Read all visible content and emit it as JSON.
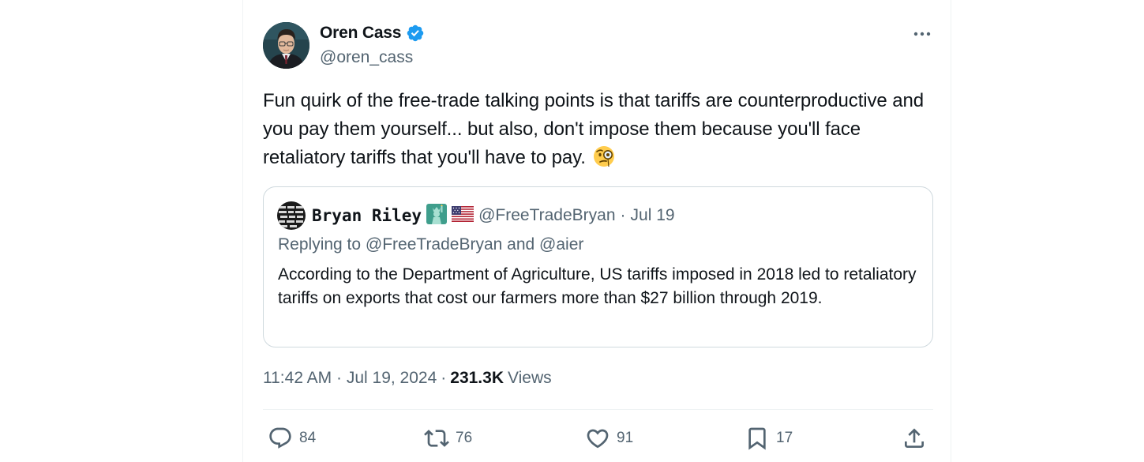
{
  "tweet": {
    "author_name": "Oren Cass",
    "author_handle": "@oren_cass",
    "text": "Fun quirk of the free-trade talking points is that tariffs are counterproductive and you pay them yourself... but also, don't impose them because you'll face retaliatory tariffs that you'll have to pay.",
    "timestamp": "11:42 AM · Jul 19, 2024",
    "separator": "·",
    "views_count": "231.3K",
    "views_label": "Views"
  },
  "quote": {
    "author_name": "Bryan Riley",
    "author_handle": "@FreeTradeBryan",
    "separator": "·",
    "date": "Jul 19",
    "replying_to": "Replying to @FreeTradeBryan and @aier",
    "text": "According to the Department of Agriculture, US tariffs imposed in 2018 led to retaliatory tariffs on exports that cost our farmers more than $27 billion through 2019."
  },
  "actions": {
    "replies": "84",
    "reposts": "76",
    "likes": "91",
    "bookmarks": "17"
  },
  "icons": {
    "verified": "verified-badge-icon",
    "more": "more-icon",
    "reply": "reply-icon",
    "repost": "repost-icon",
    "like": "heart-icon",
    "bookmark": "bookmark-icon",
    "share": "share-icon"
  },
  "colors": {
    "text_primary": "#0f1419",
    "text_secondary": "#536471",
    "verified_blue": "#1d9bf0",
    "border": "#cfd9de"
  }
}
